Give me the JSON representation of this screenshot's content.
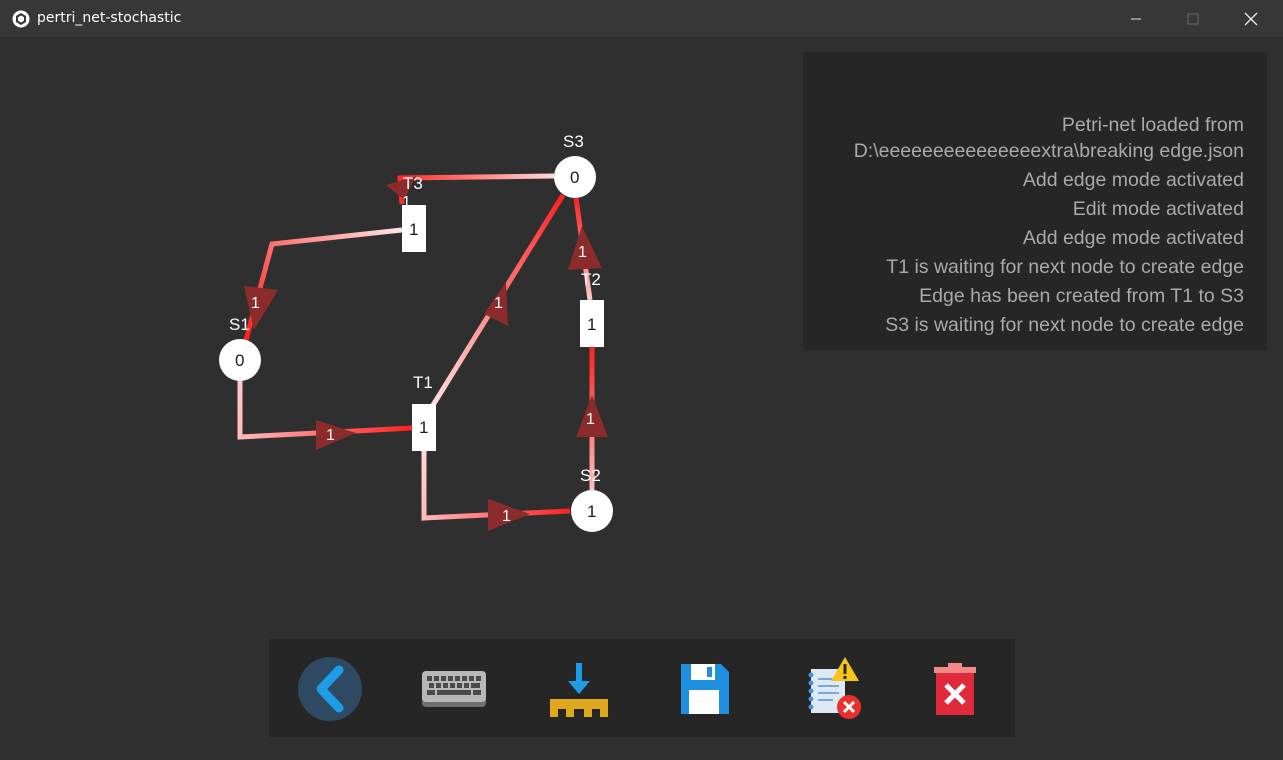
{
  "window": {
    "title": "pertri_net-stochastic",
    "minimize_icon": "minimize-icon",
    "maximize_icon": "maximize-icon",
    "close_icon": "close-icon"
  },
  "petri_net": {
    "places": [
      {
        "id": "S1",
        "label": "S1",
        "tokens": "0"
      },
      {
        "id": "S2",
        "label": "S2",
        "tokens": "1"
      },
      {
        "id": "S3",
        "label": "S3",
        "tokens": "0"
      }
    ],
    "transitions": [
      {
        "id": "T1",
        "label": "T1",
        "value": "1"
      },
      {
        "id": "T2",
        "label": "T2",
        "value": "1"
      },
      {
        "id": "T3",
        "label": "T3",
        "value": "1"
      }
    ],
    "edges": [
      {
        "from": "S1",
        "to": "T1",
        "weight": "1"
      },
      {
        "from": "T1",
        "to": "S2",
        "weight": "1"
      },
      {
        "from": "S2",
        "to": "T2",
        "weight": "1"
      },
      {
        "from": "T2",
        "to": "S3",
        "weight": "1"
      },
      {
        "from": "T1",
        "to": "S3",
        "weight": "1"
      },
      {
        "from": "S3",
        "to": "T3",
        "weight": "1"
      },
      {
        "from": "T3",
        "to": "S1",
        "weight": "1"
      }
    ],
    "edge_colors": {
      "hot": "#ff2a2a",
      "light": "#ffdcdc",
      "arrow": "#8b2b2b"
    }
  },
  "log": {
    "lines": [
      "Petri-net loaded from",
      "D:\\eeeeeeeeeeeeeeextra\\breaking edge.json",
      "Add edge mode activated",
      "Edit mode activated",
      "Add edge mode activated",
      "T1 is waiting for next node to create edge",
      "Edge has been created from T1 to S3",
      "S3 is waiting for next node to create edge"
    ]
  },
  "toolbar": {
    "buttons": [
      {
        "name": "back-button",
        "icon": "back-arrow-icon"
      },
      {
        "name": "keyboard-button",
        "icon": "keyboard-icon"
      },
      {
        "name": "import-button",
        "icon": "download-icon"
      },
      {
        "name": "save-button",
        "icon": "floppy-disk-icon"
      },
      {
        "name": "error-log-button",
        "icon": "notebook-warning-icon"
      },
      {
        "name": "delete-button",
        "icon": "trash-icon"
      }
    ]
  },
  "colors": {
    "background": "#2f2f2f",
    "panel": "#262626",
    "titlebar": "#373737",
    "log_text": "#a9a9a9",
    "back_icon_bg": "#2d4a62",
    "back_icon_fg": "#1e9ce8",
    "save_icon": "#1f8fe0",
    "import_icon": "#e0a81e",
    "delete_icon": "#e02a3c"
  }
}
